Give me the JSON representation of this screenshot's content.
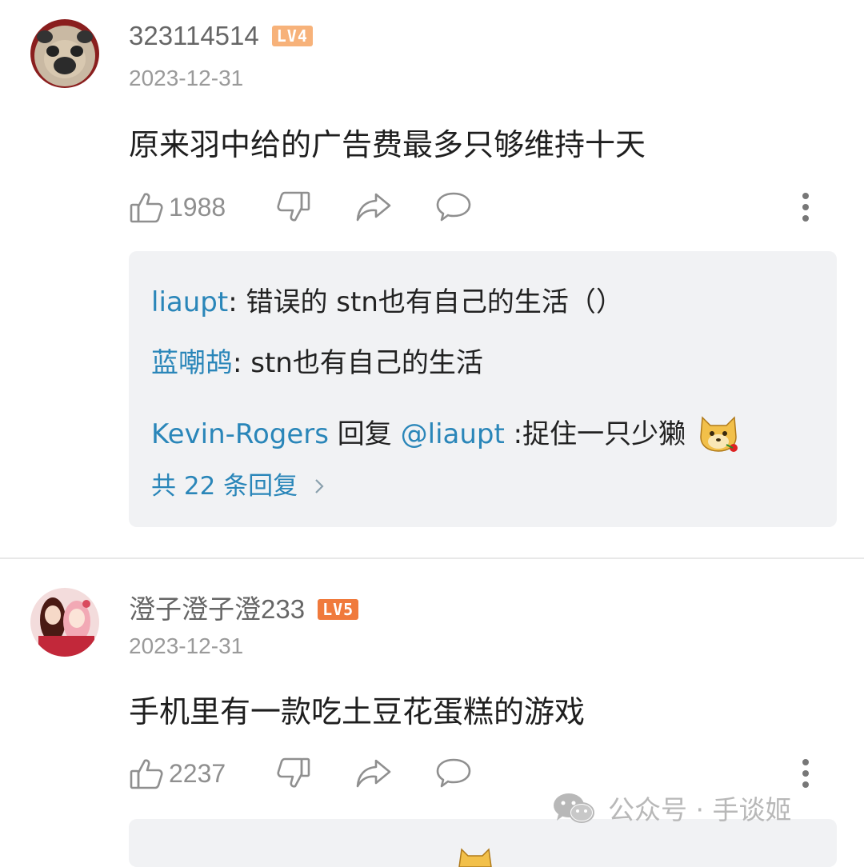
{
  "comments": [
    {
      "username": "323114514",
      "level": "LV4",
      "level_color": "#f7b27a",
      "date": "2023-12-31",
      "text": "原来羽中给的广告费最多只够维持十天",
      "likes": "1988",
      "replies": [
        {
          "name": "liaupt",
          "sep": ": ",
          "text": "错误的 stn也有自己的生活（）"
        },
        {
          "name": "蓝嘲鸪",
          "sep": ": ",
          "text": "stn也有自己的生活"
        },
        {
          "name": "Kevin-Rogers",
          "mid": " 回复 ",
          "target": "@liaupt",
          "text": " :捉住一只少獭"
        }
      ],
      "more_replies": "共 22 条回复"
    },
    {
      "username": "澄子澄子澄233",
      "level": "LV5",
      "level_color": "#f07a3c",
      "date": "2023-12-31",
      "text": "手机里有一款吃土豆花蛋糕的游戏",
      "likes": "2237"
    }
  ],
  "watermark": {
    "icon": "wechat-icon",
    "text": "公众号 · 手谈姬"
  },
  "colors": {
    "link": "#2a86b9",
    "reply_bg": "#f1f2f4",
    "muted": "#9a9a9a"
  }
}
